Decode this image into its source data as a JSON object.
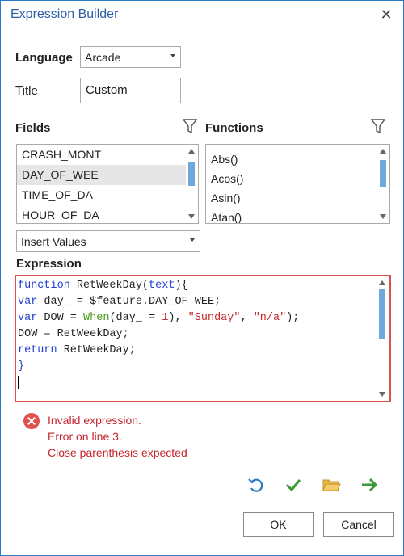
{
  "window": {
    "title": "Expression Builder"
  },
  "language": {
    "label": "Language",
    "value": "Arcade"
  },
  "title_field": {
    "label": "Title",
    "value": "Custom"
  },
  "fields": {
    "label": "Fields",
    "items": [
      "CRASH_MONT",
      "DAY_OF_WEE",
      "TIME_OF_DA",
      "HOUR_OF_DA"
    ],
    "selected_index": 1
  },
  "functions": {
    "label": "Functions",
    "items": [
      "Abs()",
      "Acos()",
      "Asin()",
      "Atan()"
    ]
  },
  "insert_values": {
    "value": "Insert Values"
  },
  "expression": {
    "label": "Expression",
    "lines": [
      "function RetWeekDay(text){",
      "var day_ = $feature.DAY_OF_WEE;",
      "var DOW = When(day_ = 1), \"Sunday\", \"n/a\");",
      "DOW = RetWeekDay;",
      "return RetWeekDay;",
      "}"
    ]
  },
  "error": {
    "line1": "Invalid expression.",
    "line2": "Error on line 3.",
    "line3": "Close parenthesis expected"
  },
  "toolbar": {
    "icons": [
      "undo-icon",
      "verify-icon",
      "open-folder-icon",
      "export-arrow-icon"
    ]
  },
  "buttons": {
    "ok": "OK",
    "cancel": "Cancel"
  },
  "colors": {
    "accent": "#2a7ac9",
    "error": "#c4262e",
    "keyword": "#1f3fd0",
    "function": "#4a9a1f"
  }
}
